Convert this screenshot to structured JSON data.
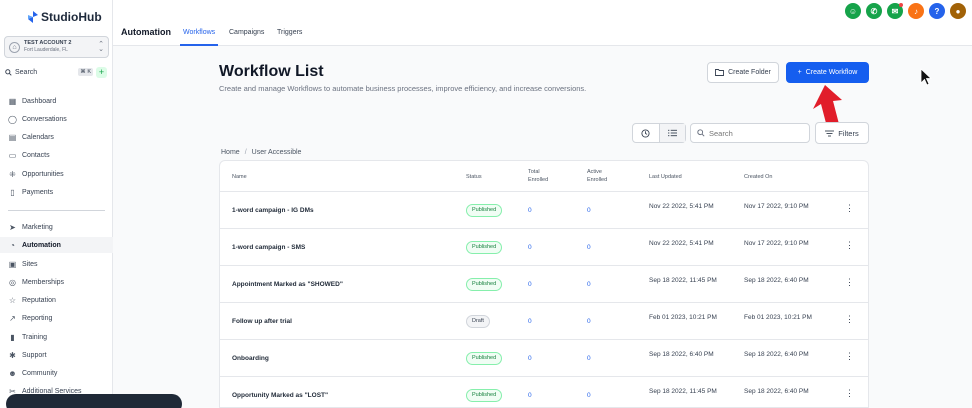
{
  "app": {
    "logo": "StudioHub",
    "account_name": "TEST ACCOUNT 2",
    "account_location": "Fort Lauderdale, FL",
    "search_label": "Search",
    "search_shortcut": "⌘ K"
  },
  "sidebar": {
    "items": [
      {
        "label": "Dashboard",
        "icon": "dashboard-icon"
      },
      {
        "label": "Conversations",
        "icon": "chat-icon"
      },
      {
        "label": "Calendars",
        "icon": "calendar-icon"
      },
      {
        "label": "Contacts",
        "icon": "contacts-icon"
      },
      {
        "label": "Opportunities",
        "icon": "opportunities-icon"
      },
      {
        "label": "Payments",
        "icon": "payments-icon"
      },
      {
        "label": "Marketing",
        "icon": "send-icon"
      },
      {
        "label": "Automation",
        "icon": "automation-icon"
      },
      {
        "label": "Sites",
        "icon": "sites-icon"
      },
      {
        "label": "Memberships",
        "icon": "memberships-icon"
      },
      {
        "label": "Reputation",
        "icon": "star-icon"
      },
      {
        "label": "Reporting",
        "icon": "chart-icon"
      },
      {
        "label": "Training",
        "icon": "book-icon"
      },
      {
        "label": "Support",
        "icon": "support-icon"
      },
      {
        "label": "Community",
        "icon": "community-icon"
      },
      {
        "label": "Additional Services",
        "icon": "services-icon"
      }
    ]
  },
  "header": {
    "title": "Automation",
    "tabs": [
      {
        "label": "Workflows"
      },
      {
        "label": "Campaigns"
      },
      {
        "label": "Triggers"
      }
    ],
    "help_label": "?"
  },
  "page": {
    "title": "Workflow List",
    "subtitle": "Create and manage Workflows to automate business processes, improve efficiency, and increase conversions.",
    "create_folder_label": "Create Folder",
    "create_workflow_label": "Create Workflow",
    "search_placeholder": "Search",
    "filters_label": "Filters",
    "breadcrumb": [
      "Home",
      "User Accessible"
    ]
  },
  "table": {
    "columns": {
      "name": "Name",
      "status": "Status",
      "total_enrolled": "Total Enrolled",
      "active_enrolled": "Active Enrolled",
      "last_updated": "Last Updated",
      "created_on": "Created On"
    },
    "rows": [
      {
        "name": "1-word campaign - IG DMs",
        "status": "Published",
        "total": "0",
        "active": "0",
        "updated": "Nov 22 2022, 5:41 PM",
        "created": "Nov 17 2022, 9:10 PM"
      },
      {
        "name": "1-word campaign - SMS",
        "status": "Published",
        "total": "0",
        "active": "0",
        "updated": "Nov 22 2022, 5:41 PM",
        "created": "Nov 17 2022, 9:10 PM"
      },
      {
        "name": "Appointment Marked as \"SHOWED\"",
        "status": "Published",
        "total": "0",
        "active": "0",
        "updated": "Sep 18 2022, 11:45 PM",
        "created": "Sep 18 2022, 6:40 PM"
      },
      {
        "name": "Follow up after trial",
        "status": "Draft",
        "total": "0",
        "active": "0",
        "updated": "Feb 01 2023, 10:21 PM",
        "created": "Feb 01 2023, 10:21 PM"
      },
      {
        "name": "Onboarding",
        "status": "Published",
        "total": "0",
        "active": "0",
        "updated": "Sep 18 2022, 6:40 PM",
        "created": "Sep 18 2022, 6:40 PM"
      },
      {
        "name": "Opportunity Marked as \"LOST\"",
        "status": "Published",
        "total": "0",
        "active": "0",
        "updated": "Sep 18 2022, 11:45 PM",
        "created": "Sep 18 2022, 6:40 PM"
      }
    ]
  },
  "colors": {
    "accent": "#155eef",
    "published": "#15803d",
    "arrow": "#e11d2a"
  }
}
